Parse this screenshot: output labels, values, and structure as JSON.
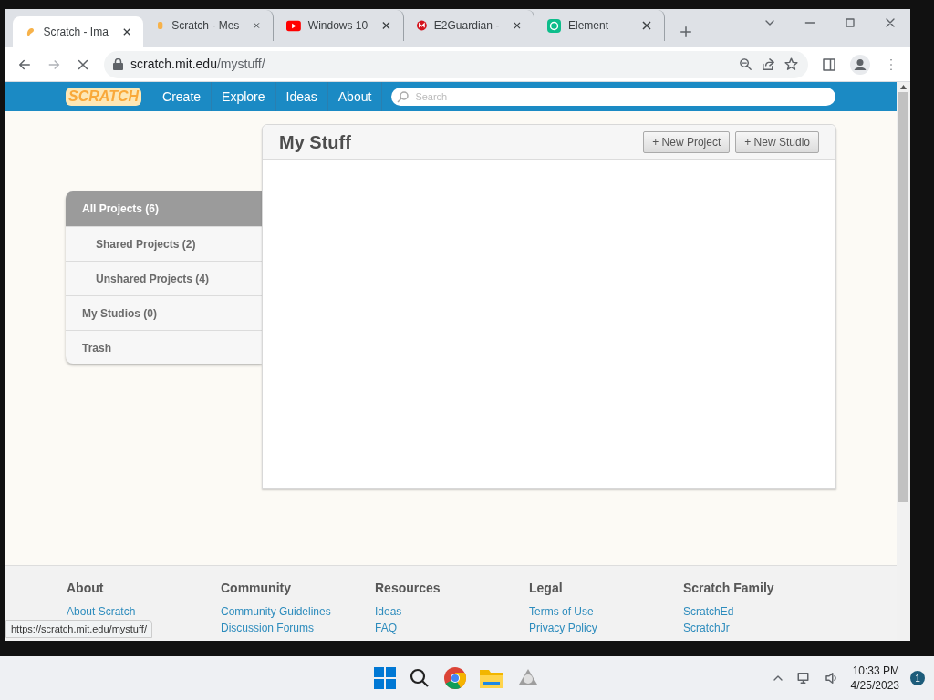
{
  "tabs": [
    {
      "title": "Scratch - Ima",
      "kind": "scratch",
      "selected": true
    },
    {
      "title": "Scratch - Mes",
      "kind": "page",
      "selected": false
    },
    {
      "title": "Windows 10",
      "kind": "video",
      "selected": false
    },
    {
      "title": "E2Guardian -",
      "kind": "shield",
      "selected": false
    },
    {
      "title": "Element",
      "kind": "element",
      "selected": false
    }
  ],
  "address": {
    "host": "scratch.mit.edu",
    "path": "/mystuff/"
  },
  "nav": {
    "logo": "SCRATCH",
    "links": [
      "Create",
      "Explore",
      "Ideas",
      "About"
    ],
    "search_placeholder": "Search"
  },
  "mystuff": {
    "title": "My Stuff",
    "buttons": [
      "+ New Project",
      "+ New Studio"
    ],
    "sidebar": [
      {
        "label": "All Projects (6)",
        "sub": false,
        "selected": true
      },
      {
        "label": "Shared Projects (2)",
        "sub": true,
        "selected": false
      },
      {
        "label": "Unshared Projects (4)",
        "sub": true,
        "selected": false
      },
      {
        "label": "My Studios (0)",
        "sub": false,
        "selected": false
      },
      {
        "label": "Trash",
        "sub": false,
        "selected": false
      }
    ]
  },
  "footer": [
    {
      "heading": "About",
      "links": [
        "About Scratch"
      ]
    },
    {
      "heading": "Community",
      "links": [
        "Community Guidelines",
        "Discussion Forums"
      ]
    },
    {
      "heading": "Resources",
      "links": [
        "Ideas",
        "FAQ"
      ]
    },
    {
      "heading": "Legal",
      "links": [
        "Terms of Use",
        "Privacy Policy"
      ]
    },
    {
      "heading": "Scratch Family",
      "links": [
        "ScratchEd",
        "ScratchJr"
      ]
    }
  ],
  "status_url": "https://scratch.mit.edu/mystuff/",
  "taskbar": {
    "time": "10:33 PM",
    "date": "4/25/2023",
    "notifications": "1"
  }
}
